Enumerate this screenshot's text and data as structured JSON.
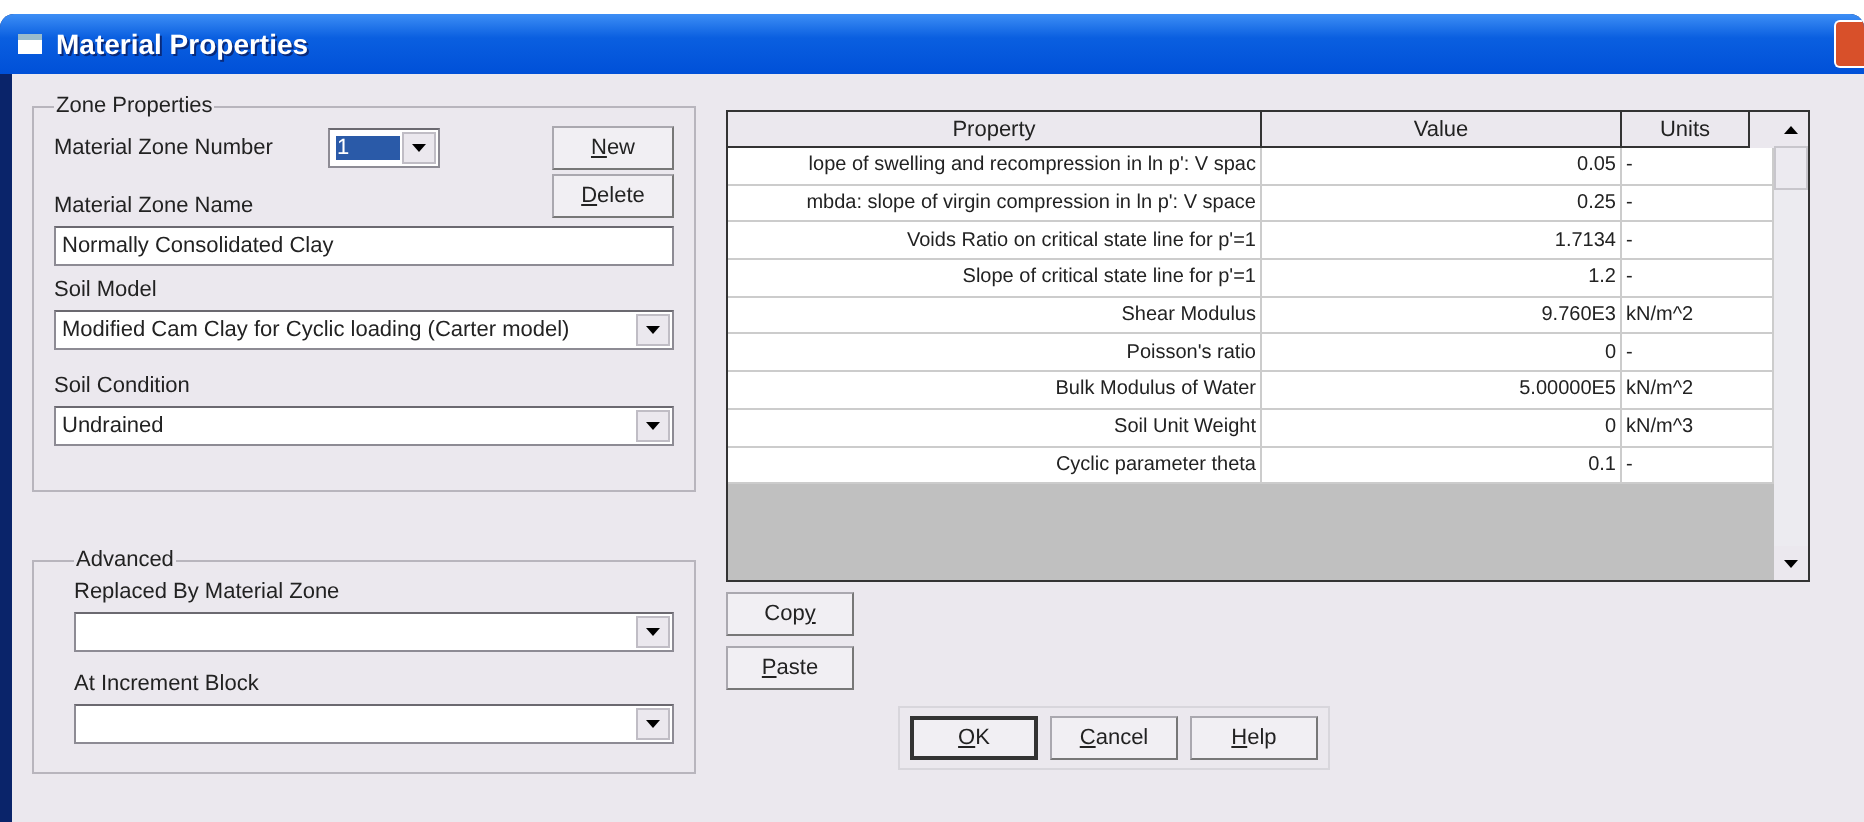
{
  "window": {
    "title": "Material Properties"
  },
  "zone_properties": {
    "title": "Zone Properties",
    "number_label": "Material Zone Number",
    "number_value": "1",
    "number_selected": true,
    "new_button": {
      "access_key": "N",
      "after": "ew"
    },
    "delete_button": {
      "access_key": "D",
      "after": "elete"
    },
    "name_label": "Material Zone Name",
    "name_value": "Normally Consolidated Clay",
    "soil_model_label": "Soil Model",
    "soil_model_value": "Modified Cam Clay for Cyclic loading (Carter model)",
    "soil_condition_label": "Soil Condition",
    "soil_condition_value": "Undrained"
  },
  "advanced": {
    "title": "Advanced",
    "replaced_label": "Replaced By Material Zone",
    "increment_label": "At Increment Block"
  },
  "table": {
    "columns": [
      "Property",
      "Value",
      "Units"
    ],
    "rows": [
      {
        "property": "lope of swelling and recompression in ln p': V spac",
        "value": "0.05",
        "units": "-"
      },
      {
        "property": "mbda: slope of virgin compression in ln p': V space",
        "value": "0.25",
        "units": "-"
      },
      {
        "property": "Voids Ratio on critical state line for p'=1",
        "value": "1.7134",
        "units": "-"
      },
      {
        "property": "Slope of critical state line for p'=1",
        "value": "1.2",
        "units": "-"
      },
      {
        "property": "Shear Modulus",
        "value": "9.760E3",
        "units": "kN/m^2"
      },
      {
        "property": "Poisson's ratio",
        "value": "0",
        "units": "-"
      },
      {
        "property": "Bulk Modulus of Water",
        "value": "5.00000E5",
        "units": "kN/m^2"
      },
      {
        "property": "Soil Unit Weight",
        "value": "0",
        "units": "kN/m^3"
      },
      {
        "property": "Cyclic parameter theta",
        "value": "0.1",
        "units": "-"
      }
    ]
  },
  "side_buttons": [
    {
      "before": "Cop",
      "access_key": "y"
    },
    {
      "access_key": "P",
      "after": "aste"
    }
  ],
  "dialog_buttons": [
    {
      "access_key": "O",
      "after": "K",
      "default": true
    },
    {
      "access_key": "C",
      "after": "ancel",
      "default": false
    },
    {
      "access_key": "H",
      "after": "elp",
      "default": false
    }
  ]
}
